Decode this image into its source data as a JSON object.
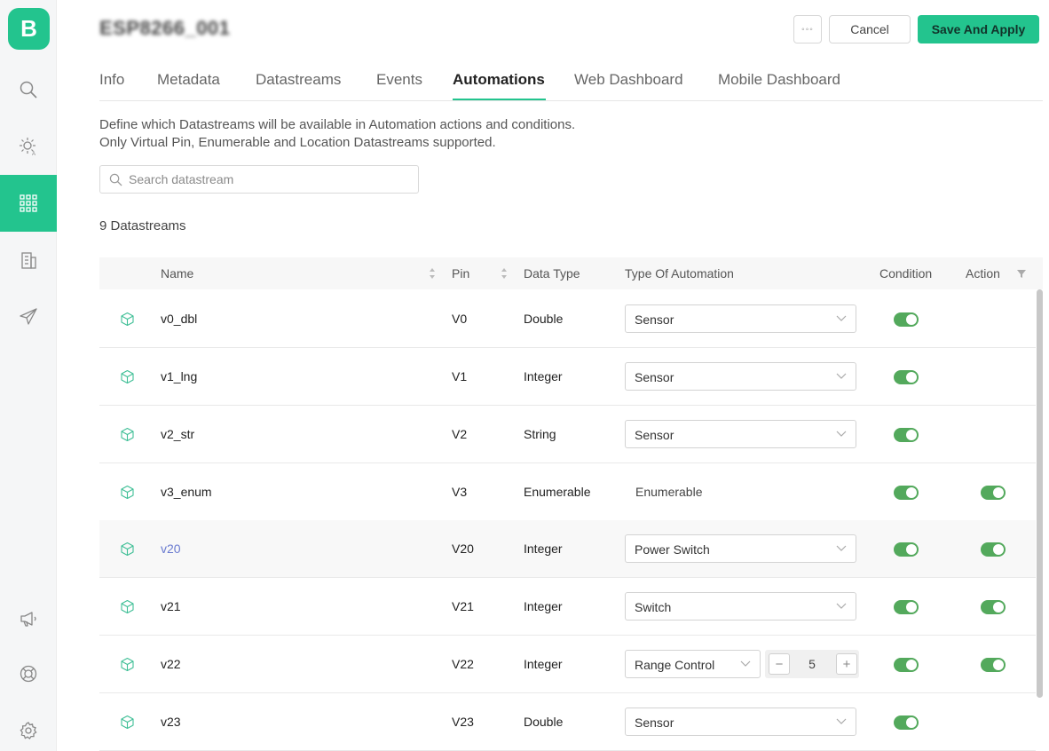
{
  "app": {
    "logo_letter": "B"
  },
  "sidebar": {
    "items": [
      {
        "icon": "search-icon"
      },
      {
        "icon": "sun-icon"
      },
      {
        "icon": "apps-grid-icon",
        "active": true
      },
      {
        "icon": "building-icon"
      },
      {
        "icon": "paper-plane-icon"
      },
      {
        "icon": "megaphone-icon"
      },
      {
        "icon": "lifebuoy-icon"
      },
      {
        "icon": "gear-icon"
      }
    ]
  },
  "header": {
    "device_title": "ESP8266_001",
    "more_label": "◦◦◦",
    "cancel_label": "Cancel",
    "save_label": "Save And Apply"
  },
  "tabs": [
    {
      "label": "Info"
    },
    {
      "label": "Metadata"
    },
    {
      "label": "Datastreams"
    },
    {
      "label": "Events"
    },
    {
      "label": "Automations",
      "active": true
    },
    {
      "label": "Web Dashboard"
    },
    {
      "label": "Mobile Dashboard"
    }
  ],
  "description": {
    "line1": "Define which Datastreams will be available in Automation actions and conditions.",
    "line2": "Only Virtual Pin, Enumerable and Location Datastreams supported."
  },
  "search": {
    "placeholder": "Search datastream",
    "value": ""
  },
  "datastream_count": "9 Datastreams",
  "table": {
    "columns": [
      "Name",
      "Pin",
      "Data Type",
      "Type Of Automation",
      "Condition",
      "Action"
    ],
    "rows": [
      {
        "name": "v0_dbl",
        "pin": "V0",
        "data_type": "Double",
        "automation": "Sensor",
        "condition": true,
        "action": null
      },
      {
        "name": "v1_lng",
        "pin": "V1",
        "data_type": "Integer",
        "automation": "Sensor",
        "condition": true,
        "action": null
      },
      {
        "name": "v2_str",
        "pin": "V2",
        "data_type": "String",
        "automation": "Sensor",
        "condition": true,
        "action": null
      },
      {
        "name": "v3_enum",
        "pin": "V3",
        "data_type": "Enumerable",
        "automation": "Enumerable",
        "condition": true,
        "action": true
      },
      {
        "name": "v20",
        "pin": "V20",
        "data_type": "Integer",
        "automation": "Power Switch",
        "condition": true,
        "action": true
      },
      {
        "name": "v21",
        "pin": "V21",
        "data_type": "Integer",
        "automation": "Switch",
        "condition": true,
        "action": true
      },
      {
        "name": "v22",
        "pin": "V22",
        "data_type": "Integer",
        "automation": "Range Control",
        "step_value": "5",
        "condition": true,
        "action": true
      },
      {
        "name": "v23",
        "pin": "V23",
        "data_type": "Double",
        "automation": "Sensor",
        "condition": true,
        "action": null
      }
    ]
  },
  "stepper": {
    "minus": "−",
    "plus": "+"
  },
  "colors": {
    "accent": "#23c48e",
    "toggle_on": "#53a95c",
    "link": "#6a7bd0"
  }
}
